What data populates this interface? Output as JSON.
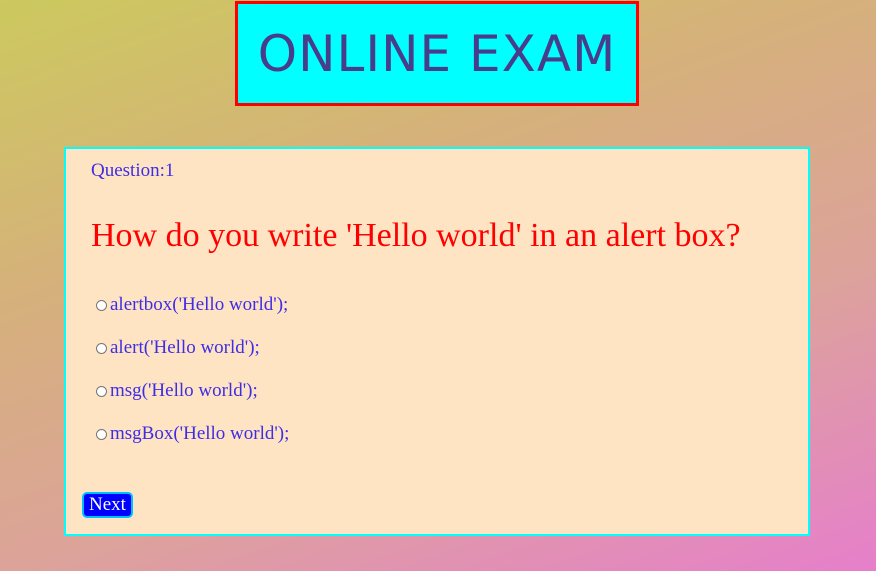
{
  "header": {
    "title": "ONLINE EXAM"
  },
  "question": {
    "number_label": "Question:1",
    "text": "How do you write 'Hello world' in an alert box?",
    "options": [
      "alertbox('Hello world');",
      "alert('Hello world');",
      "msg('Hello world');",
      "msgBox('Hello world');"
    ]
  },
  "controls": {
    "next_label": "Next"
  },
  "colors": {
    "title_bg": "#00ffff",
    "title_border": "#ff0000",
    "title_text": "#483d8b",
    "card_bg": "#ffe4c4",
    "card_border": "#00ffff",
    "question_text": "#ff0000",
    "option_text": "#3d2ee6",
    "button_bg": "#0000ff"
  }
}
